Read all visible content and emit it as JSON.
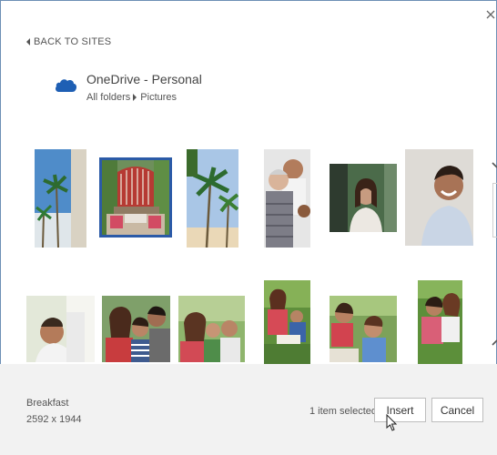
{
  "header": {
    "back_label": "BACK TO SITES"
  },
  "location": {
    "service": "OneDrive - Personal",
    "breadcrumb": [
      "All folders",
      "Pictures"
    ]
  },
  "icons": {
    "close": "close-icon",
    "back": "chevron-left-icon",
    "service": "onedrive-cloud-icon",
    "crumb_sep": "chevron-right-icon",
    "scroll": "chevron-icon"
  },
  "gallery": {
    "selected_index": 1,
    "row1_count": 6,
    "row2_count": 6
  },
  "footer": {
    "file_name": "Breakfast",
    "file_dimensions": "2592 x 1944",
    "status": "1 item selected.",
    "insert_label": "Insert",
    "cancel_label": "Cancel"
  },
  "colors": {
    "accent": "#2b5aa7",
    "onedrive_blue": "#1e5fb4",
    "footer_bg": "#f2f2f2"
  }
}
